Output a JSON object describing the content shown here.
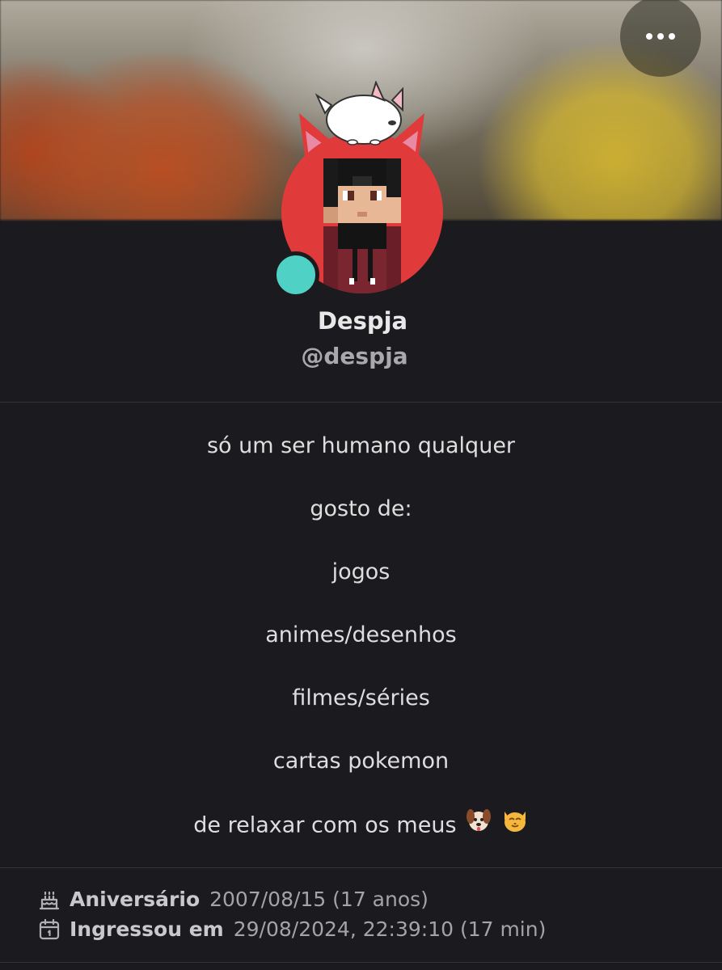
{
  "header": {
    "more_icon": "more-horizontal-icon"
  },
  "profile": {
    "display_name": "Despja",
    "username": "@despja",
    "status_color": "#4fd1c5",
    "avatar_color": "#e03a3a"
  },
  "bio": {
    "lines": [
      "só um ser humano qualquer",
      "gosto de:",
      "jogos",
      "animes/desenhos",
      "filmes/séries",
      "cartas pokemon",
      "de relaxar com os meus"
    ],
    "emojis": [
      "dog-face-icon",
      "cat-face-icon"
    ]
  },
  "meta": {
    "birthday_label": "Aniversário",
    "birthday_value": "2007/08/15 (17 anos)",
    "birthday_icon": "cake-icon",
    "joined_label": "Ingressou em",
    "joined_value": "29/08/2024, 22:39:10 (17 min)",
    "joined_icon": "calendar-icon"
  }
}
